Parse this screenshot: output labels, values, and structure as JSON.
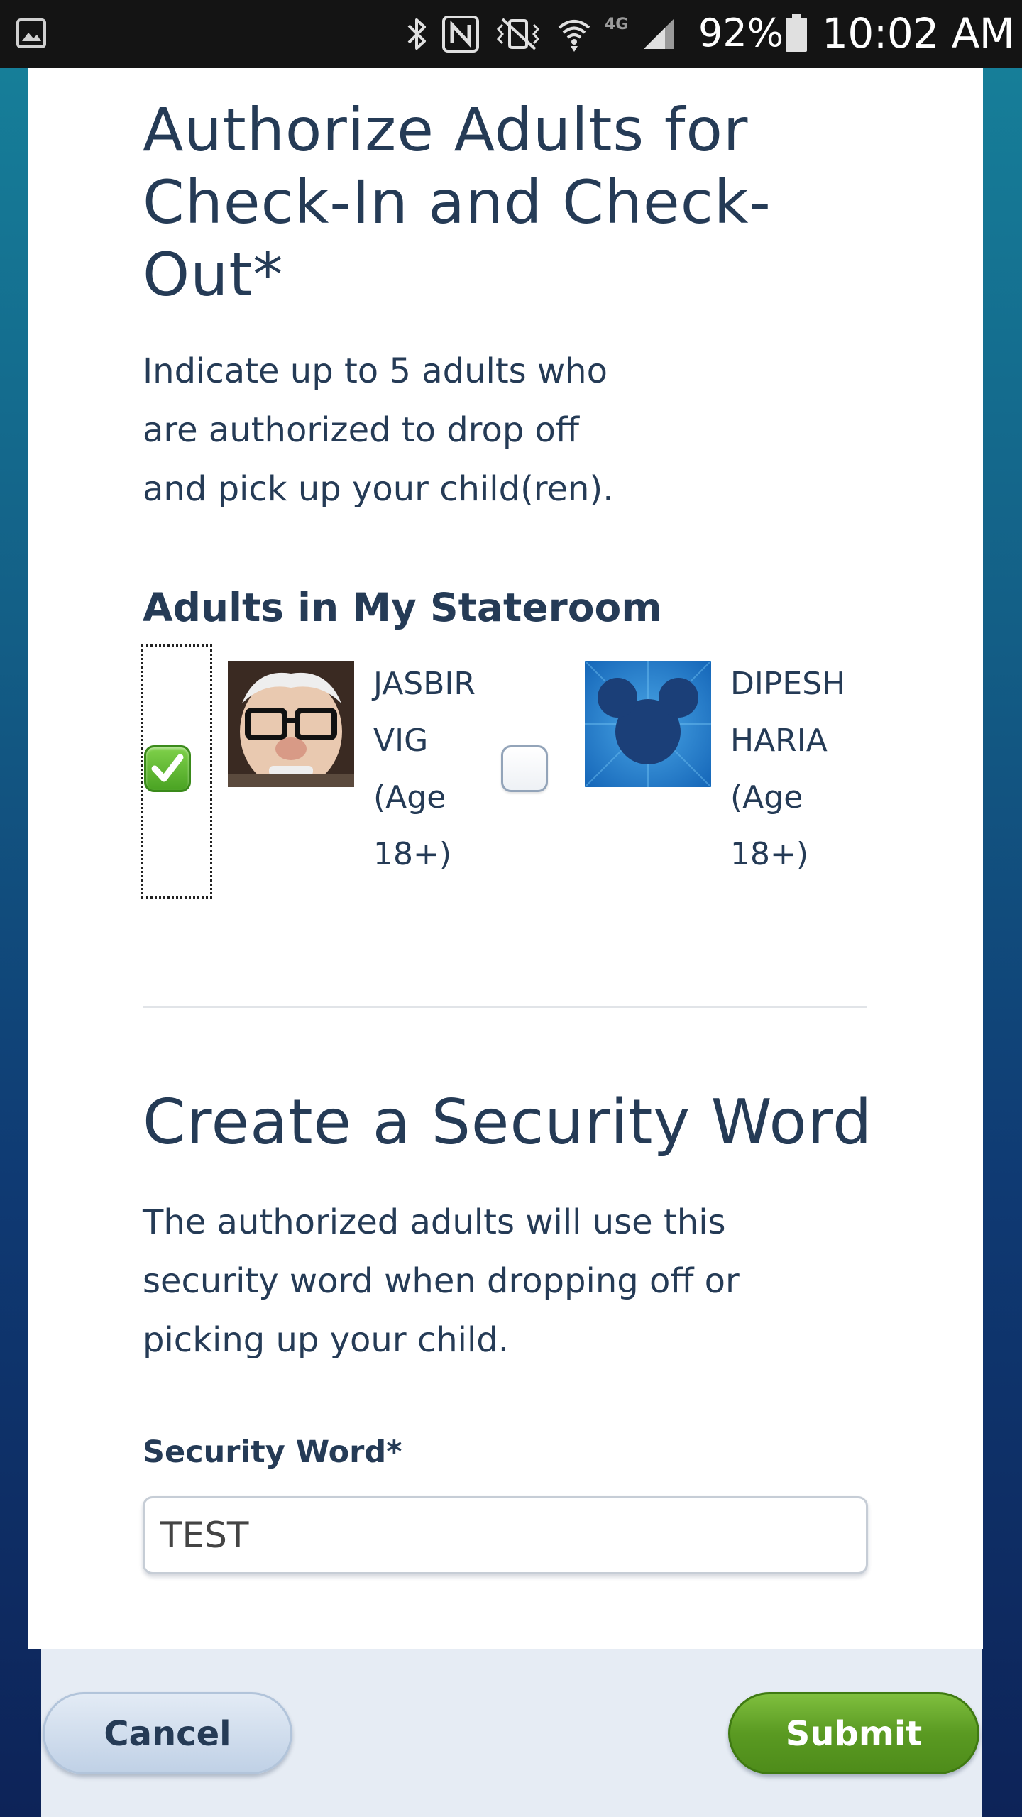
{
  "status_bar": {
    "battery_percent": "92%",
    "time": "10:02 AM",
    "network_label": "4G",
    "icons": [
      "gallery-icon",
      "bluetooth-icon",
      "nfc-icon",
      "vibrate-mute-icon",
      "wifi-icon",
      "signal-icon",
      "battery-icon"
    ]
  },
  "authorize": {
    "title": "Authorize Adults for Check-In and Check-Out*",
    "description": "Indicate up to 5 adults who are authorized to drop off and pick up your child(ren).",
    "section_label": "Adults in My Stateroom",
    "adults": [
      {
        "name_line1": "JASBIR",
        "name_line2": "VIG",
        "age_line1": "(Age",
        "age_line2": "18+)",
        "checked": true,
        "avatar": "carl-avatar-icon"
      },
      {
        "name_line1": "DIPESH",
        "name_line2": "HARIA",
        "age_line1": "(Age",
        "age_line2": "18+)",
        "checked": false,
        "avatar": "mickey-avatar-icon"
      }
    ]
  },
  "security": {
    "title": "Create a Security Word",
    "description": "The authorized adults will use this security word when dropping off or picking up your child.",
    "field_label": "Security Word*",
    "field_value": "TEST"
  },
  "footer": {
    "cancel_label": "Cancel",
    "submit_label": "Submit"
  },
  "colors": {
    "heading": "#253b56",
    "submit_green": "#5a9a22",
    "cancel_blue": "#c0d1e6",
    "footer_bg": "#e6ecf4"
  }
}
